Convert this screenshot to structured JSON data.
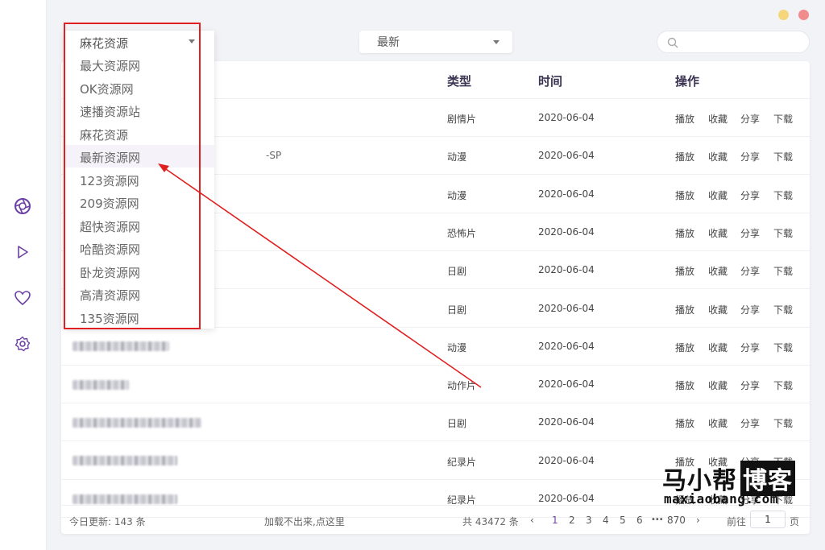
{
  "sidebar": {
    "icons": [
      "aperture-icon",
      "play-icon",
      "heart-icon",
      "gear-icon"
    ]
  },
  "colors": {
    "accent": "#6c3fa6",
    "red": "#e02020"
  },
  "filters": {
    "source_selected": "麻花资源",
    "sort_selected": "最新"
  },
  "dropdown": {
    "items": [
      "最大资源网",
      "OK资源网",
      "速播资源站",
      "麻花资源",
      "最新资源网",
      "123资源网",
      "209资源网",
      "超快资源网",
      "哈酷资源网",
      "卧龙资源网",
      "高清资源网",
      "135资源网"
    ],
    "highlighted": "最新资源网"
  },
  "table": {
    "headers": {
      "type": "类型",
      "time": "时间",
      "action": "操作"
    },
    "actions": [
      "播放",
      "收藏",
      "分享",
      "下载"
    ],
    "rows": [
      {
        "name_suffix": "",
        "type": "剧情片",
        "time": "2020-06-04"
      },
      {
        "name_suffix": "-SP",
        "type": "动漫",
        "time": "2020-06-04"
      },
      {
        "name_suffix": "",
        "type": "动漫",
        "time": "2020-06-04"
      },
      {
        "name_suffix": "",
        "type": "恐怖片",
        "time": "2020-06-04"
      },
      {
        "name_suffix": "",
        "type": "日剧",
        "time": "2020-06-04"
      },
      {
        "name_suffix": "",
        "type": "日剧",
        "time": "2020-06-04"
      },
      {
        "name_suffix": "",
        "type": "动漫",
        "time": "2020-06-04"
      },
      {
        "name_suffix": "",
        "type": "动作片",
        "time": "2020-06-04"
      },
      {
        "name_suffix": "",
        "type": "日剧",
        "time": "2020-06-04"
      },
      {
        "name_suffix": "",
        "type": "纪录片",
        "time": "2020-06-04"
      },
      {
        "name_suffix": "",
        "type": "纪录片",
        "time": "2020-06-04"
      }
    ]
  },
  "footer": {
    "today_updates": "今日更新: 143 条",
    "load_hint": "加载不出来,点这里",
    "total": "共 43472 条",
    "prev": "‹",
    "pages": [
      "1",
      "2",
      "3",
      "4",
      "5",
      "6"
    ],
    "ellipsis": "•••",
    "last_page": "870",
    "next": "›",
    "goto_label": "前往",
    "goto_value": "1",
    "page_unit": "页"
  },
  "watermark": {
    "cn_main": "马小帮",
    "cn_box": "博客",
    "en": "maxiaobang.com"
  }
}
